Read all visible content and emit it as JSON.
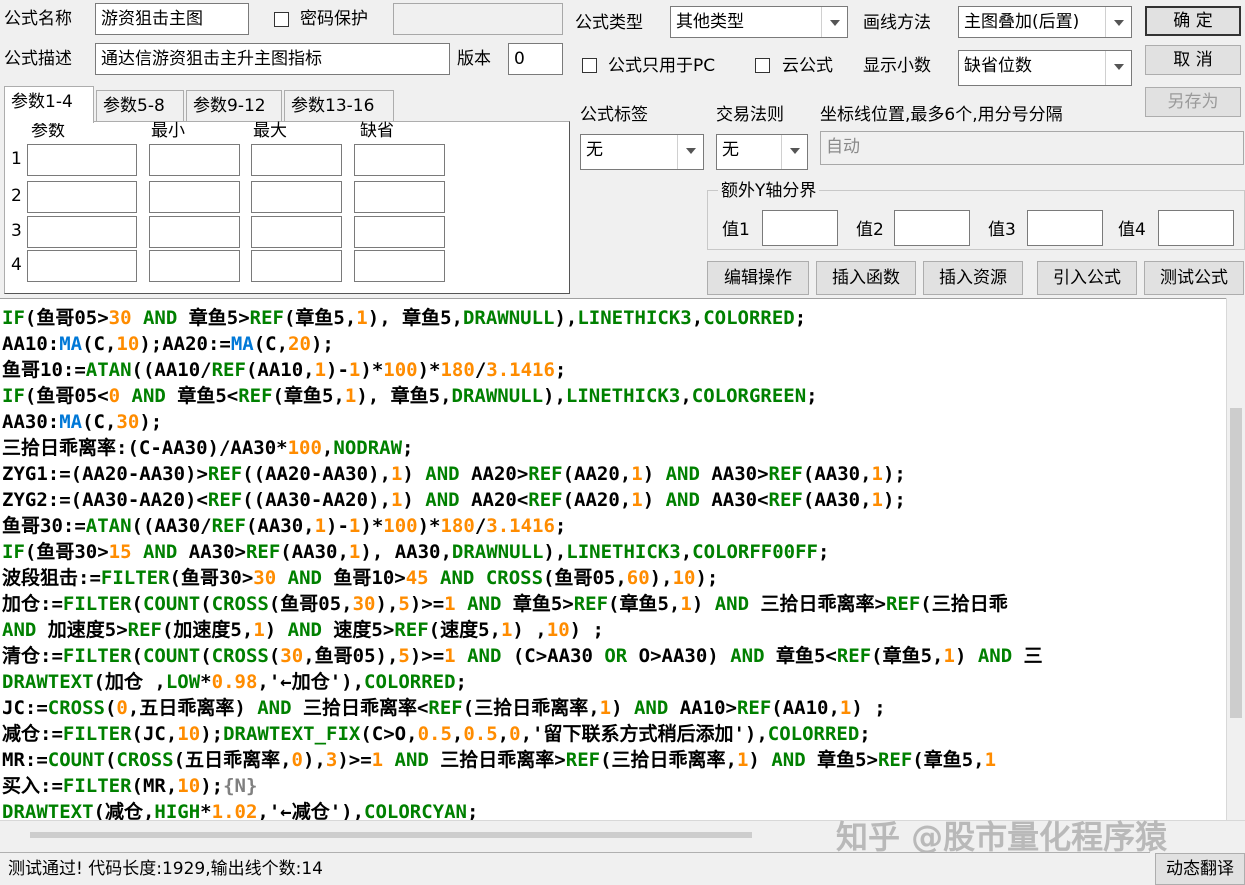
{
  "form": {
    "name_label": "公式名称",
    "name_value": "游资狙击主图",
    "password_label": "密码保护",
    "password_value": "",
    "desc_label": "公式描述",
    "desc_value": "通达信游资狙击主升主图指标",
    "version_label": "版本",
    "version_value": "0",
    "type_label": "公式类型",
    "type_value": "其他类型",
    "draw_label": "画线方法",
    "draw_value": "主图叠加(后置)",
    "pc_only_label": "公式只用于PC",
    "cloud_label": "云公式",
    "decimals_label": "显示小数",
    "decimals_value": "缺省位数",
    "tag_label": "公式标签",
    "tag_value": "无",
    "trade_label": "交易法则",
    "trade_value": "无",
    "axis_label": "坐标线位置,最多6个,用分号分隔",
    "axis_value": "自动",
    "extra_y_label": "额外Y轴分界",
    "v1_label": "值1",
    "v2_label": "值2",
    "v3_label": "值3",
    "v4_label": "值4"
  },
  "buttons": {
    "ok": "确  定",
    "cancel": "取  消",
    "save_as": "另存为",
    "edit_ops": "编辑操作",
    "insert_func": "插入函数",
    "insert_res": "插入资源",
    "import_formula": "引入公式",
    "test_formula": "测试公式",
    "dynamic_translate": "动态翻译"
  },
  "tabs": [
    "参数1-4",
    "参数5-8",
    "参数9-12",
    "参数13-16"
  ],
  "param_table": {
    "headers": [
      "参数",
      "最小",
      "最大",
      "缺省"
    ],
    "rows": [
      "1",
      "2",
      "3",
      "4"
    ]
  },
  "status": "测试通过! 代码长度:1929,输出线个数:14",
  "watermark": "知乎 @股市量化程序猿",
  "colors": {
    "keyword": "#008000",
    "number": "#ff8c00",
    "function": "#0078d7"
  },
  "code_lines": [
    [
      [
        "k",
        "IF"
      ],
      [
        "t",
        "(鱼哥05>"
      ],
      [
        "n",
        "30"
      ],
      [
        "k",
        " AND "
      ],
      [
        "t",
        "章鱼5>"
      ],
      [
        "k",
        "REF"
      ],
      [
        "t",
        "(章鱼5,"
      ],
      [
        "n",
        "1"
      ],
      [
        "t",
        "), 章鱼5,"
      ],
      [
        "k",
        "DRAWNULL"
      ],
      [
        "t",
        "),"
      ],
      [
        "k",
        "LINETHICK3"
      ],
      [
        "t",
        ","
      ],
      [
        "k",
        "COLORRED"
      ],
      [
        "t",
        ";"
      ]
    ],
    [
      [
        "t",
        "AA10:"
      ],
      [
        "f",
        "MA"
      ],
      [
        "t",
        "(C,"
      ],
      [
        "n",
        "10"
      ],
      [
        "t",
        ");AA20:="
      ],
      [
        "f",
        "MA"
      ],
      [
        "t",
        "(C,"
      ],
      [
        "n",
        "20"
      ],
      [
        "t",
        ");"
      ]
    ],
    [
      [
        "t",
        "鱼哥10:="
      ],
      [
        "k",
        "ATAN"
      ],
      [
        "t",
        "((AA10/"
      ],
      [
        "k",
        "REF"
      ],
      [
        "t",
        "(AA10,"
      ],
      [
        "n",
        "1"
      ],
      [
        "t",
        ")-"
      ],
      [
        "n",
        "1"
      ],
      [
        "t",
        ")*"
      ],
      [
        "n",
        "100"
      ],
      [
        "t",
        ")*"
      ],
      [
        "n",
        "180"
      ],
      [
        "t",
        "/"
      ],
      [
        "n",
        "3.1416"
      ],
      [
        "t",
        ";"
      ]
    ],
    [
      [
        "k",
        "IF"
      ],
      [
        "t",
        "(鱼哥05<"
      ],
      [
        "n",
        "0"
      ],
      [
        "k",
        " AND "
      ],
      [
        "t",
        "章鱼5<"
      ],
      [
        "k",
        "REF"
      ],
      [
        "t",
        "(章鱼5,"
      ],
      [
        "n",
        "1"
      ],
      [
        "t",
        "), 章鱼5,"
      ],
      [
        "k",
        "DRAWNULL"
      ],
      [
        "t",
        "),"
      ],
      [
        "k",
        "LINETHICK3"
      ],
      [
        "t",
        ","
      ],
      [
        "k",
        "COLORGREEN"
      ],
      [
        "t",
        ";"
      ]
    ],
    [
      [
        "t",
        "AA30:"
      ],
      [
        "f",
        "MA"
      ],
      [
        "t",
        "(C,"
      ],
      [
        "n",
        "30"
      ],
      [
        "t",
        ");"
      ]
    ],
    [
      [
        "t",
        "三拾日乖离率:(C-AA30)/AA30*"
      ],
      [
        "n",
        "100"
      ],
      [
        "t",
        ","
      ],
      [
        "k",
        "NODRAW"
      ],
      [
        "t",
        ";"
      ]
    ],
    [
      [
        "t",
        "ZYG1:=(AA20-AA30)>"
      ],
      [
        "k",
        "REF"
      ],
      [
        "t",
        "((AA20-AA30),"
      ],
      [
        "n",
        "1"
      ],
      [
        "t",
        ")"
      ],
      [
        "k",
        " AND "
      ],
      [
        "t",
        "AA20>"
      ],
      [
        "k",
        "REF"
      ],
      [
        "t",
        "(AA20,"
      ],
      [
        "n",
        "1"
      ],
      [
        "t",
        ")"
      ],
      [
        "k",
        " AND "
      ],
      [
        "t",
        "AA30>"
      ],
      [
        "k",
        "REF"
      ],
      [
        "t",
        "(AA30,"
      ],
      [
        "n",
        "1"
      ],
      [
        "t",
        ");"
      ]
    ],
    [
      [
        "t",
        "ZYG2:=(AA30-AA20)<"
      ],
      [
        "k",
        "REF"
      ],
      [
        "t",
        "((AA30-AA20),"
      ],
      [
        "n",
        "1"
      ],
      [
        "t",
        ")"
      ],
      [
        "k",
        " AND "
      ],
      [
        "t",
        "AA20<"
      ],
      [
        "k",
        "REF"
      ],
      [
        "t",
        "(AA20,"
      ],
      [
        "n",
        "1"
      ],
      [
        "t",
        ")"
      ],
      [
        "k",
        " AND "
      ],
      [
        "t",
        "AA30<"
      ],
      [
        "k",
        "REF"
      ],
      [
        "t",
        "(AA30,"
      ],
      [
        "n",
        "1"
      ],
      [
        "t",
        ");"
      ]
    ],
    [
      [
        "t",
        "鱼哥30:="
      ],
      [
        "k",
        "ATAN"
      ],
      [
        "t",
        "((AA30/"
      ],
      [
        "k",
        "REF"
      ],
      [
        "t",
        "(AA30,"
      ],
      [
        "n",
        "1"
      ],
      [
        "t",
        ")-"
      ],
      [
        "n",
        "1"
      ],
      [
        "t",
        ")*"
      ],
      [
        "n",
        "100"
      ],
      [
        "t",
        ")*"
      ],
      [
        "n",
        "180"
      ],
      [
        "t",
        "/"
      ],
      [
        "n",
        "3.1416"
      ],
      [
        "t",
        ";"
      ]
    ],
    [
      [
        "k",
        "IF"
      ],
      [
        "t",
        "(鱼哥30>"
      ],
      [
        "n",
        "15"
      ],
      [
        "k",
        " AND "
      ],
      [
        "t",
        "AA30>"
      ],
      [
        "k",
        "REF"
      ],
      [
        "t",
        "(AA30,"
      ],
      [
        "n",
        "1"
      ],
      [
        "t",
        "), AA30,"
      ],
      [
        "k",
        "DRAWNULL"
      ],
      [
        "t",
        "),"
      ],
      [
        "k",
        "LINETHICK3"
      ],
      [
        "t",
        ","
      ],
      [
        "k",
        "COLORFF00FF"
      ],
      [
        "t",
        ";"
      ]
    ],
    [
      [
        "t",
        "波段狙击:="
      ],
      [
        "k",
        "FILTER"
      ],
      [
        "t",
        "(鱼哥30>"
      ],
      [
        "n",
        "30"
      ],
      [
        "k",
        " AND "
      ],
      [
        "t",
        "鱼哥10>"
      ],
      [
        "n",
        "45"
      ],
      [
        "k",
        " AND "
      ],
      [
        "k",
        "CROSS"
      ],
      [
        "t",
        "(鱼哥05,"
      ],
      [
        "n",
        "60"
      ],
      [
        "t",
        "),"
      ],
      [
        "n",
        "10"
      ],
      [
        "t",
        ");"
      ]
    ],
    [
      [
        "t",
        "加仓:="
      ],
      [
        "k",
        "FILTER"
      ],
      [
        "t",
        "("
      ],
      [
        "k",
        "COUNT"
      ],
      [
        "t",
        "("
      ],
      [
        "k",
        "CROSS"
      ],
      [
        "t",
        "(鱼哥05,"
      ],
      [
        "n",
        "30"
      ],
      [
        "t",
        "),"
      ],
      [
        "n",
        "5"
      ],
      [
        "t",
        ")>="
      ],
      [
        "n",
        "1"
      ],
      [
        "k",
        " AND "
      ],
      [
        "t",
        "章鱼5>"
      ],
      [
        "k",
        "REF"
      ],
      [
        "t",
        "(章鱼5,"
      ],
      [
        "n",
        "1"
      ],
      [
        "t",
        ")"
      ],
      [
        "k",
        " AND "
      ],
      [
        "t",
        "三拾日乖离率>"
      ],
      [
        "k",
        "REF"
      ],
      [
        "t",
        "(三拾日乖"
      ]
    ],
    [
      [
        "k",
        "AND "
      ],
      [
        "t",
        "加速度5>"
      ],
      [
        "k",
        "REF"
      ],
      [
        "t",
        "(加速度5,"
      ],
      [
        "n",
        "1"
      ],
      [
        "t",
        ")"
      ],
      [
        "k",
        " AND "
      ],
      [
        "t",
        "速度5>"
      ],
      [
        "k",
        "REF"
      ],
      [
        "t",
        "(速度5,"
      ],
      [
        "n",
        "1"
      ],
      [
        "t",
        ") ,"
      ],
      [
        "n",
        "10"
      ],
      [
        "t",
        ") ;"
      ]
    ],
    [
      [
        "t",
        "清仓:="
      ],
      [
        "k",
        "FILTER"
      ],
      [
        "t",
        "("
      ],
      [
        "k",
        "COUNT"
      ],
      [
        "t",
        "("
      ],
      [
        "k",
        "CROSS"
      ],
      [
        "t",
        "("
      ],
      [
        "n",
        "30"
      ],
      [
        "t",
        ",鱼哥05),"
      ],
      [
        "n",
        "5"
      ],
      [
        "t",
        ")>="
      ],
      [
        "n",
        "1"
      ],
      [
        "k",
        " AND "
      ],
      [
        "t",
        "(C>AA30"
      ],
      [
        "k",
        " OR "
      ],
      [
        "t",
        "O>AA30)"
      ],
      [
        "k",
        " AND "
      ],
      [
        "t",
        "章鱼5<"
      ],
      [
        "k",
        "REF"
      ],
      [
        "t",
        "(章鱼5,"
      ],
      [
        "n",
        "1"
      ],
      [
        "t",
        ")"
      ],
      [
        "k",
        " AND "
      ],
      [
        "t",
        "三"
      ]
    ],
    [
      [
        "k",
        "DRAWTEXT"
      ],
      [
        "t",
        "(加仓 ,"
      ],
      [
        "k",
        "LOW"
      ],
      [
        "t",
        "*"
      ],
      [
        "n",
        "0.98"
      ],
      [
        "t",
        ",'←加仓'),"
      ],
      [
        "k",
        "COLORRED"
      ],
      [
        "t",
        ";"
      ]
    ],
    [
      [
        "t",
        "JC:="
      ],
      [
        "k",
        "CROSS"
      ],
      [
        "t",
        "("
      ],
      [
        "n",
        "0"
      ],
      [
        "t",
        ",五日乖离率)"
      ],
      [
        "k",
        " AND "
      ],
      [
        "t",
        "三拾日乖离率<"
      ],
      [
        "k",
        "REF"
      ],
      [
        "t",
        "(三拾日乖离率,"
      ],
      [
        "n",
        "1"
      ],
      [
        "t",
        ")"
      ],
      [
        "k",
        " AND "
      ],
      [
        "t",
        "AA10>"
      ],
      [
        "k",
        "REF"
      ],
      [
        "t",
        "(AA10,"
      ],
      [
        "n",
        "1"
      ],
      [
        "t",
        ") ;"
      ]
    ],
    [
      [
        "t",
        "减仓:="
      ],
      [
        "k",
        "FILTER"
      ],
      [
        "t",
        "(JC,"
      ],
      [
        "n",
        "10"
      ],
      [
        "t",
        ");"
      ],
      [
        "k",
        "DRAWTEXT_FIX"
      ],
      [
        "t",
        "(C>O,"
      ],
      [
        "n",
        "0.5"
      ],
      [
        "t",
        ","
      ],
      [
        "n",
        "0.5"
      ],
      [
        "t",
        ","
      ],
      [
        "n",
        "0"
      ],
      [
        "t",
        ",'留下联系方式稍后添加'),"
      ],
      [
        "k",
        "COLORRED"
      ],
      [
        "t",
        ";"
      ]
    ],
    [
      [
        "t",
        "MR:="
      ],
      [
        "k",
        "COUNT"
      ],
      [
        "t",
        "("
      ],
      [
        "k",
        "CROSS"
      ],
      [
        "t",
        "(五日乖离率,"
      ],
      [
        "n",
        "0"
      ],
      [
        "t",
        "),"
      ],
      [
        "n",
        "3"
      ],
      [
        "t",
        ")>="
      ],
      [
        "n",
        "1"
      ],
      [
        "k",
        " AND "
      ],
      [
        "t",
        "三拾日乖离率>"
      ],
      [
        "k",
        "REF"
      ],
      [
        "t",
        "(三拾日乖离率,"
      ],
      [
        "n",
        "1"
      ],
      [
        "t",
        ")"
      ],
      [
        "k",
        " AND "
      ],
      [
        "t",
        "章鱼5>"
      ],
      [
        "k",
        "REF"
      ],
      [
        "t",
        "(章鱼5,"
      ],
      [
        "n",
        "1"
      ]
    ],
    [
      [
        "t",
        "买入:="
      ],
      [
        "k",
        "FILTER"
      ],
      [
        "t",
        "(MR,"
      ],
      [
        "n",
        "10"
      ],
      [
        "t",
        ");"
      ],
      [
        "c",
        "{N}"
      ]
    ],
    [
      [
        "k",
        "DRAWTEXT"
      ],
      [
        "t",
        "(减仓,"
      ],
      [
        "k",
        "HIGH"
      ],
      [
        "t",
        "*"
      ],
      [
        "n",
        "1.02"
      ],
      [
        "t",
        ",'←减仓'),"
      ],
      [
        "k",
        "COLORCYAN"
      ],
      [
        "t",
        ";"
      ]
    ]
  ]
}
